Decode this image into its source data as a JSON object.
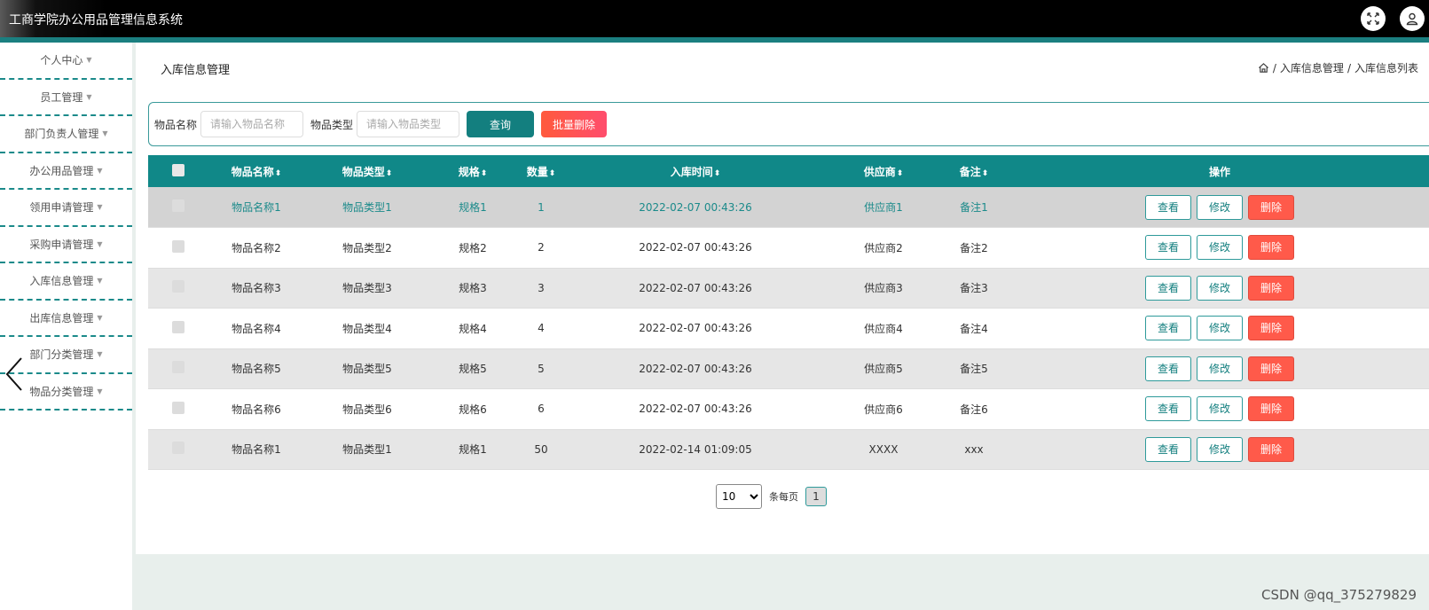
{
  "app": {
    "title": "工商学院办公用品管理信息系统"
  },
  "header_icons": {
    "fullscreen": "fullscreen-icon",
    "user": "user-icon"
  },
  "sidebar": {
    "items": [
      {
        "label": "个人中心"
      },
      {
        "label": "员工管理"
      },
      {
        "label": "部门负责人管理"
      },
      {
        "label": "办公用品管理"
      },
      {
        "label": "领用申请管理"
      },
      {
        "label": "采购申请管理"
      },
      {
        "label": "入库信息管理"
      },
      {
        "label": "出库信息管理"
      },
      {
        "label": "部门分类管理"
      },
      {
        "label": "物品分类管理"
      }
    ],
    "caret": "▼"
  },
  "page": {
    "title": "入库信息管理",
    "breadcrumb": {
      "sep": "/",
      "level1": "入库信息管理",
      "level2": "入库信息列表"
    }
  },
  "search": {
    "name_label": "物品名称",
    "name_placeholder": "请输入物品名称",
    "type_label": "物品类型",
    "type_placeholder": "请输入物品类型",
    "query_label": "查询",
    "batch_delete_label": "批量删除"
  },
  "table": {
    "sort_glyph": "⬍",
    "columns": [
      "物品名称",
      "物品类型",
      "规格",
      "数量",
      "入库时间",
      "供应商",
      "备注",
      "操作"
    ],
    "rows": [
      {
        "name": "物品名称1",
        "type": "物品类型1",
        "spec": "规格1",
        "qty": "1",
        "time": "2022-02-07 00:43:26",
        "supplier": "供应商1",
        "note": "备注1"
      },
      {
        "name": "物品名称2",
        "type": "物品类型2",
        "spec": "规格2",
        "qty": "2",
        "time": "2022-02-07 00:43:26",
        "supplier": "供应商2",
        "note": "备注2"
      },
      {
        "name": "物品名称3",
        "type": "物品类型3",
        "spec": "规格3",
        "qty": "3",
        "time": "2022-02-07 00:43:26",
        "supplier": "供应商3",
        "note": "备注3"
      },
      {
        "name": "物品名称4",
        "type": "物品类型4",
        "spec": "规格4",
        "qty": "4",
        "time": "2022-02-07 00:43:26",
        "supplier": "供应商4",
        "note": "备注4"
      },
      {
        "name": "物品名称5",
        "type": "物品类型5",
        "spec": "规格5",
        "qty": "5",
        "time": "2022-02-07 00:43:26",
        "supplier": "供应商5",
        "note": "备注5"
      },
      {
        "name": "物品名称6",
        "type": "物品类型6",
        "spec": "规格6",
        "qty": "6",
        "time": "2022-02-07 00:43:26",
        "supplier": "供应商6",
        "note": "备注6"
      },
      {
        "name": "物品名称1",
        "type": "物品类型1",
        "spec": "规格1",
        "qty": "50",
        "time": "2022-02-14 01:09:05",
        "supplier": "XXXX",
        "note": "xxx"
      }
    ],
    "actions": {
      "view": "查看",
      "edit": "修改",
      "delete": "删除"
    }
  },
  "pager": {
    "page_size": "10",
    "per_page_label": "条每页",
    "current_page": "1"
  },
  "watermark": "CSDN @qq_375279829",
  "colors": {
    "teal": "#108888",
    "danger": "#ff5a4a",
    "topbar": "#000000"
  }
}
